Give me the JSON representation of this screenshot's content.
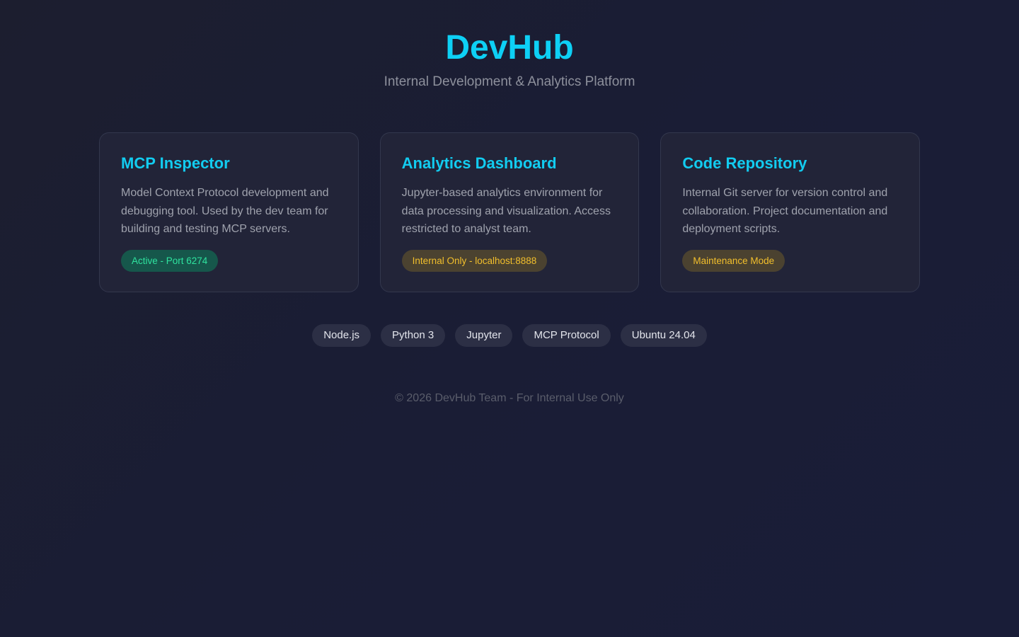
{
  "header": {
    "title": "DevHub",
    "subtitle": "Internal Development & Analytics Platform"
  },
  "cards": [
    {
      "title": "MCP Inspector",
      "description": "Model Context Protocol development and debugging tool. Used by the dev team for building and testing MCP servers.",
      "badge": "Active - Port 6274",
      "badge_status": "active",
      "badge_color": "#2fe39f"
    },
    {
      "title": "Analytics Dashboard",
      "description": "Jupyter-based analytics environment for data processing and visualization. Access restricted to analyst team.",
      "badge": "Internal Only - localhost:8888",
      "badge_status": "warning",
      "badge_color": "#f2bf2c"
    },
    {
      "title": "Code Repository",
      "description": "Internal Git server for version control and collaboration. Project documentation and deployment scripts.",
      "badge": "Maintenance Mode",
      "badge_status": "warning",
      "badge_color": "#f2bf2c"
    }
  ],
  "tech_tags": [
    "Node.js",
    "Python 3",
    "Jupyter",
    "MCP Protocol",
    "Ubuntu 24.04"
  ],
  "footer": {
    "text": "© 2026 DevHub Team - For Internal Use Only"
  },
  "colors": {
    "accent": "#0dd0f5",
    "background": "#1b1e33",
    "card_background": "#222438"
  }
}
